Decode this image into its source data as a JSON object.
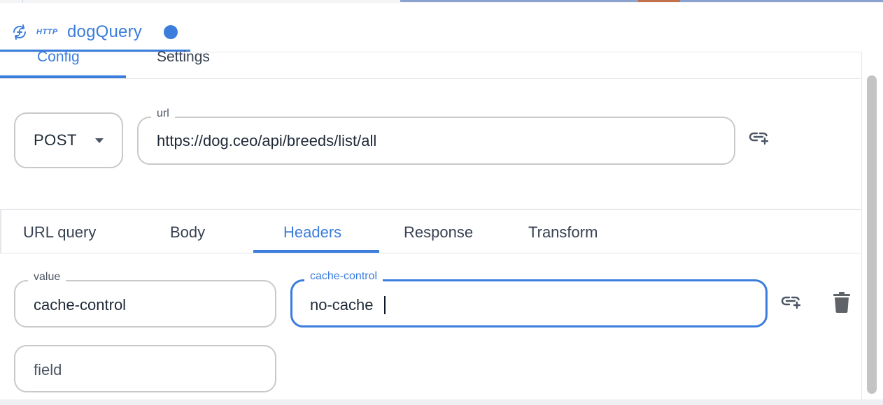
{
  "query": {
    "type_badge": "HTTP",
    "name": "dogQuery",
    "unsaved": true,
    "accent_color": "#3b7ddd"
  },
  "config_tabs": {
    "active": "Config",
    "items": [
      {
        "label": "Config"
      },
      {
        "label": "Settings"
      }
    ]
  },
  "request": {
    "method": "POST",
    "url_label": "url",
    "url": "https://dog.ceo/api/breeds/list/all"
  },
  "sub_tabs": {
    "active": "Headers",
    "items": [
      {
        "label": "URL query"
      },
      {
        "label": "Body"
      },
      {
        "label": "Headers"
      },
      {
        "label": "Response"
      },
      {
        "label": "Transform"
      }
    ]
  },
  "headers": {
    "rows": [
      {
        "key_label": "value",
        "key": "cache-control",
        "value_label": "cache-control",
        "value": "no-cache"
      }
    ],
    "new_field_placeholder": "field"
  },
  "icons": {
    "title_icon": "query-refresh-icon",
    "link_icon": "add-link-icon",
    "delete_icon": "trash-icon",
    "dropdown_icon": "caret-down-icon"
  }
}
